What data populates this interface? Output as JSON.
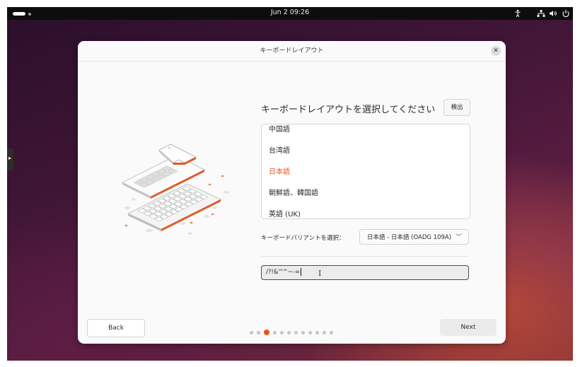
{
  "topbar": {
    "clock": "Jun 2  09:26",
    "icons": [
      "activities-pill",
      "accessibility-icon",
      "network-icon",
      "volume-icon",
      "power-icon"
    ]
  },
  "dialog": {
    "title": "キーボードレイアウト",
    "heading": "キーボードレイアウトを選択してください",
    "detect_label": "検出",
    "layouts": [
      "中国語",
      "台湾語",
      "日本語",
      "朝鮮語、韓国語",
      "英語 (UK)"
    ],
    "selected_layout": "日本語",
    "variant_label": "キーボードバリアントを選択：",
    "variant_value": "日本語 - 日本語 (OADG 109A)",
    "test_value": "/?!&'\"^~-=",
    "back_label": "Back",
    "next_label": "Next",
    "pager": {
      "total": 12,
      "current": 3
    }
  },
  "colors": {
    "accent": "#e95420",
    "dialog_bg": "#fafafa",
    "topbar_bg": "#0d0d0d"
  }
}
